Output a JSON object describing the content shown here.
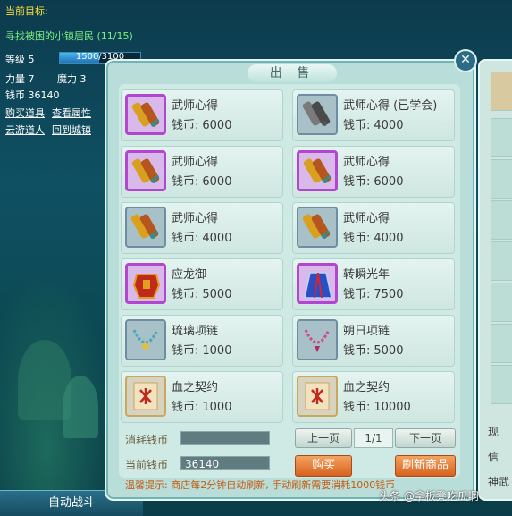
{
  "hud": {
    "goal_title": "当前目标:",
    "goal_text": "寻找被困的小镇居民 (11/15)",
    "level_label": "等级 5",
    "exp_text": "1500/3100",
    "exp_progress": 0.484,
    "strength": "力量 7",
    "magic": "魔力 3",
    "coins": "钱币 36140",
    "links": [
      "购买道具",
      "查看属性",
      "云游道人",
      "回到城镇"
    ]
  },
  "shop": {
    "title": "出 售",
    "items": [
      {
        "name": "武师心得",
        "price_label": "钱币:",
        "price": "6000",
        "icon": "scroll-icon",
        "frame": "purple"
      },
      {
        "name": "武师心得 (已学会)",
        "price_label": "钱币:",
        "price": "4000",
        "icon": "scroll-grey-icon",
        "frame": "blue"
      },
      {
        "name": "武师心得",
        "price_label": "钱币:",
        "price": "6000",
        "icon": "scroll-icon",
        "frame": "purple"
      },
      {
        "name": "武师心得",
        "price_label": "钱币:",
        "price": "6000",
        "icon": "scroll-icon",
        "frame": "purple"
      },
      {
        "name": "武师心得",
        "price_label": "钱币:",
        "price": "4000",
        "icon": "scroll-icon",
        "frame": "blue"
      },
      {
        "name": "武师心得",
        "price_label": "钱币:",
        "price": "4000",
        "icon": "scroll-icon",
        "frame": "blue"
      },
      {
        "name": "应龙御",
        "price_label": "钱币:",
        "price": "5000",
        "icon": "armor-icon",
        "frame": "purple"
      },
      {
        "name": "转瞬光年",
        "price_label": "钱币:",
        "price": "7500",
        "icon": "robe-icon",
        "frame": "purple"
      },
      {
        "name": "琉璃项链",
        "price_label": "钱币:",
        "price": "1000",
        "icon": "necklace-icon",
        "frame": "blue"
      },
      {
        "name": "朔日项链",
        "price_label": "钱币:",
        "price": "5000",
        "icon": "necklace-pink-icon",
        "frame": "blue"
      },
      {
        "name": "血之契约",
        "price_label": "钱币:",
        "price": "1000",
        "icon": "contract-icon",
        "frame": "plain"
      },
      {
        "name": "血之契约",
        "price_label": "钱币:",
        "price": "10000",
        "icon": "contract-icon",
        "frame": "plain"
      }
    ],
    "spend_label": "消耗钱币",
    "spend_value": "",
    "current_label": "当前钱币",
    "current_value": "36140",
    "prev_page": "上一页",
    "page_indicator": "1/1",
    "next_page": "下一页",
    "buy_button": "购买",
    "refresh_button": "刷新商品",
    "tip": "温馨提示: 商店每2分钟自动刷新, 手动刷新需要消耗1000钱币"
  },
  "side": {
    "texts": [
      "现",
      "信",
      "神武"
    ]
  },
  "bottom": {
    "auto_battle": "自动战斗"
  },
  "watermark": "头条 @拿板凳吃瓜啊"
}
